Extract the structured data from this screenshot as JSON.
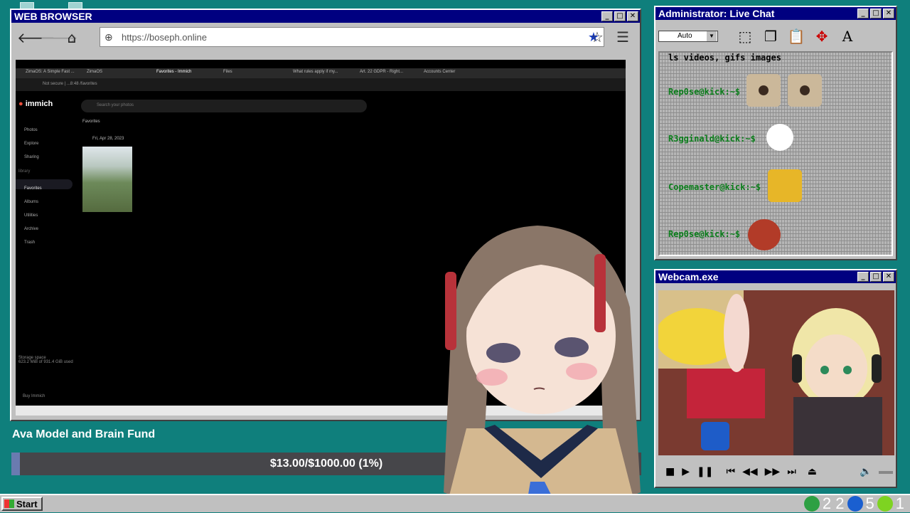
{
  "browser": {
    "title": "WEB BROWSER",
    "url": "https://boseph.online",
    "inner_tabs": [
      "ZimaOS: A Simple Fast ...",
      "ZimaOS",
      "Favorites - Immich",
      "Files",
      "What rules apply if my...",
      "Art. 22 GDPR - Right...",
      "Accounts Center"
    ],
    "inner_address": "Not secure  |  ...8:48 /favorites",
    "immich_logo": "immich",
    "search_placeholder": "Search your photos",
    "sidebar": [
      "Photos",
      "Explore",
      "Sharing",
      "Favorites",
      "Albums",
      "Utilities",
      "Archive",
      "Trash"
    ],
    "library_label": "library",
    "favorites_title": "Favorites",
    "photo_date": "Fri, Apr 28, 2023",
    "storage_label": "Storage space",
    "storage_value": "623.2 MiB of 931.4 GiB used",
    "buy_label": "Buy Immich"
  },
  "chat": {
    "title": "Administrator: Live Chat",
    "font_combo": "Auto",
    "top_text": "ls videos, gifs images",
    "messages": [
      {
        "user": "Rep0se@kick:~$",
        "emote": "eye-emote"
      },
      {
        "user": "R3gginald@kick:~$",
        "emote": "ghost-emote"
      },
      {
        "user": "Copemaster@kick:~$",
        "emote": "laugh-emote"
      },
      {
        "user": "Rep0se@kick:~$",
        "emote": "scream-emote"
      }
    ]
  },
  "webcam": {
    "title": "Webcam.exe"
  },
  "fund": {
    "title": "Ava Model and Brain Fund",
    "progress_text": "$13.00/$1000.00 (1%)",
    "progress_fraction": 0.013
  },
  "taskbar": {
    "start_label": "Start",
    "tray_count_1": "2 2",
    "tray_count_2": "5",
    "tray_count_3": "1"
  },
  "colors": {
    "desktop": "#0f7f7c",
    "titlebar": "#000080",
    "chat_name": "#0a7d1a"
  }
}
